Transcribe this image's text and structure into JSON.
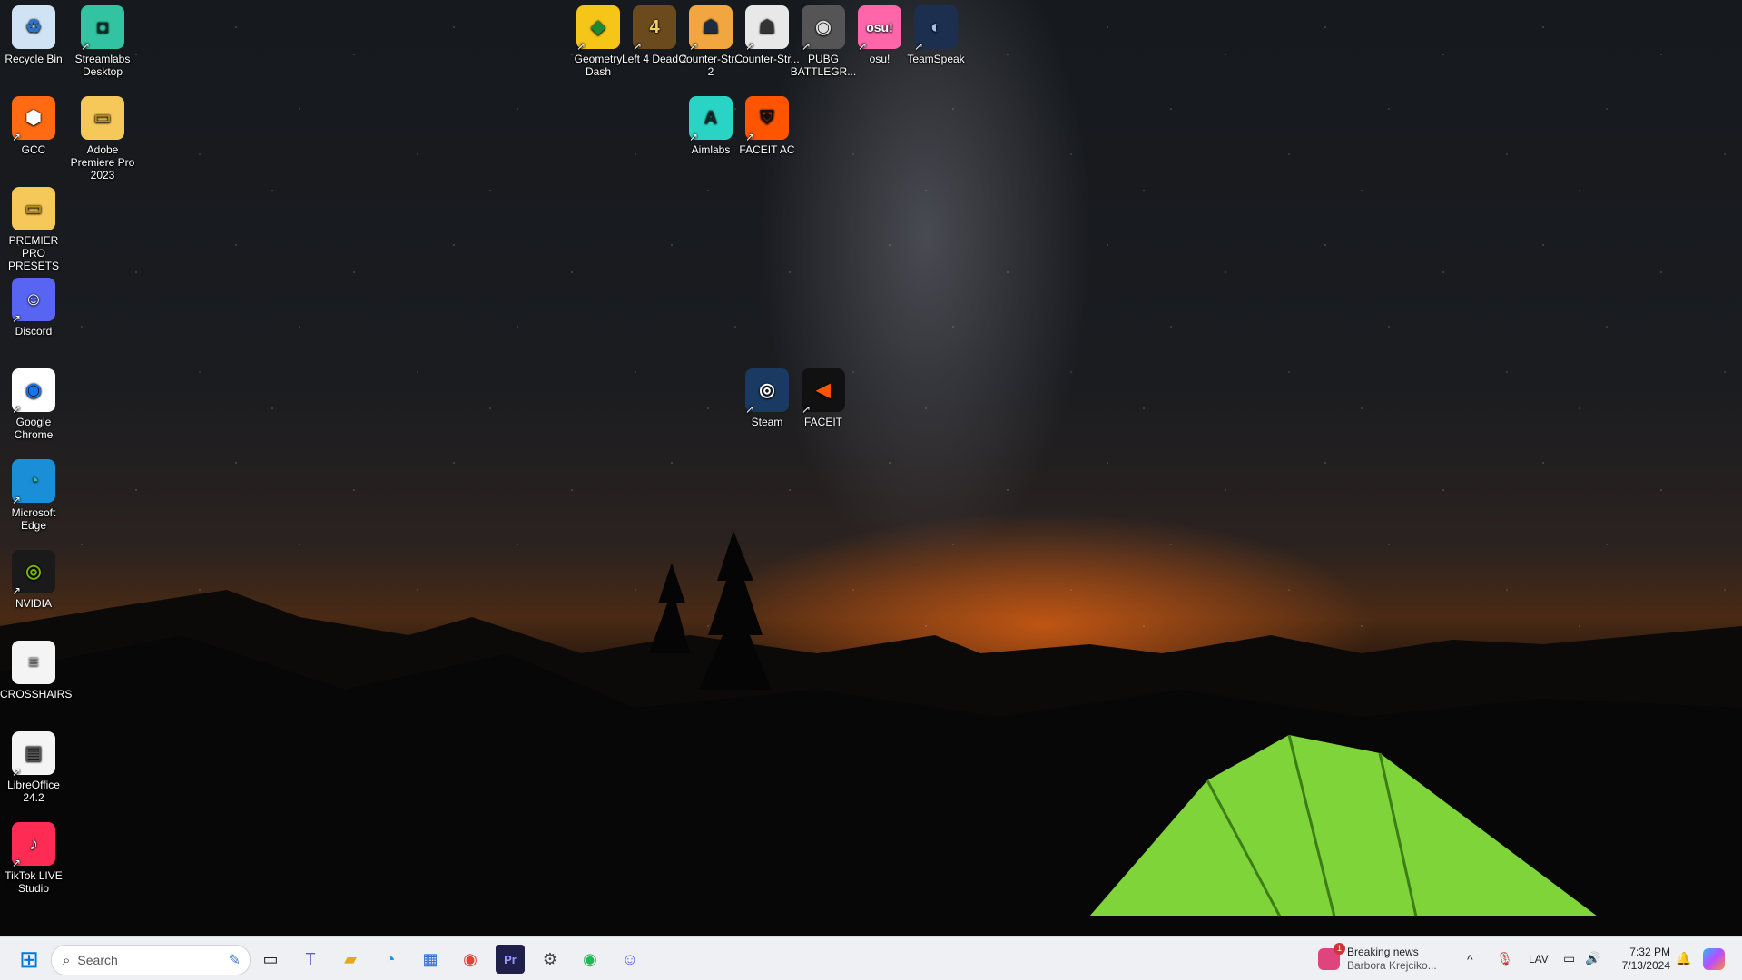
{
  "desktop": {
    "icons": [
      {
        "label": "Recycle Bin",
        "glyph": "♻",
        "bg": "#cfe3f5",
        "fg": "#2a73c9",
        "shortcut": false
      },
      {
        "label": "Streamlabs Desktop",
        "glyph": "◘",
        "bg": "#31c3a2",
        "fg": "#0a2a26",
        "shortcut": true
      },
      {
        "label": "Geometry Dash",
        "glyph": "◆",
        "bg": "#f5c518",
        "fg": "#1b8a32",
        "shortcut": true
      },
      {
        "label": "Left 4 Dead 2",
        "glyph": "4",
        "bg": "#6b4b1e",
        "fg": "#f0d060",
        "shortcut": true
      },
      {
        "label": "Counter-Str... 2",
        "glyph": "☗",
        "bg": "#f2a640",
        "fg": "#1d2b3f",
        "shortcut": true
      },
      {
        "label": "Counter-Str...",
        "glyph": "☗",
        "bg": "#e8e8e8",
        "fg": "#333",
        "shortcut": true
      },
      {
        "label": "PUBG BATTLEGR...",
        "glyph": "◉",
        "bg": "#555",
        "fg": "#ddd",
        "shortcut": true
      },
      {
        "label": "osu!",
        "glyph": "osu!",
        "bg": "#ff66aa",
        "fg": "#fff",
        "shortcut": true
      },
      {
        "label": "TeamSpeak",
        "glyph": "◐",
        "bg": "#1c2f4f",
        "fg": "#9fc3f0",
        "shortcut": true
      },
      {
        "label": "GCC",
        "glyph": "⬢",
        "bg": "#ff6a13",
        "fg": "#fff",
        "shortcut": true
      },
      {
        "label": "Adobe Premiere Pro 2023",
        "glyph": "▭",
        "bg": "#f6c85a",
        "fg": "#b88a1c",
        "shortcut": false
      },
      {
        "label": "Aimlabs",
        "glyph": "A",
        "bg": "#2ad4c4",
        "fg": "#102a2a",
        "shortcut": true
      },
      {
        "label": "FACEIT AC",
        "glyph": "⛨",
        "bg": "#ff5500",
        "fg": "#111",
        "shortcut": true
      },
      {
        "label": "PREMIER PRO PRESETS",
        "glyph": "▭",
        "bg": "#f6c85a",
        "fg": "#b88a1c",
        "shortcut": false
      },
      {
        "label": "Discord",
        "glyph": "☺",
        "bg": "#5865f2",
        "fg": "#fff",
        "shortcut": true
      },
      {
        "label": "Steam",
        "glyph": "◎",
        "bg": "#1b3a63",
        "fg": "#fff",
        "shortcut": true
      },
      {
        "label": "FACEIT",
        "glyph": "◀",
        "bg": "#111",
        "fg": "#ff5500",
        "shortcut": true
      },
      {
        "label": "Google Chrome",
        "glyph": "◉",
        "bg": "#fff",
        "fg": "#1a73e8",
        "shortcut": true
      },
      {
        "label": "Microsoft Edge",
        "glyph": "◔",
        "bg": "#1a8fd8",
        "fg": "#34c48b",
        "shortcut": true
      },
      {
        "label": "NVIDIA",
        "glyph": "◎",
        "bg": "#1a1a1a",
        "fg": "#76b900",
        "shortcut": true
      },
      {
        "label": "CROSSHAIRS",
        "glyph": "≡",
        "bg": "#f4f4f4",
        "fg": "#aaa",
        "shortcut": false
      },
      {
        "label": "LibreOffice 24.2",
        "glyph": "▤",
        "bg": "#f4f4f4",
        "fg": "#555",
        "shortcut": true
      },
      {
        "label": "TikTok LIVE Studio",
        "glyph": "♪",
        "bg": "#fe2c55",
        "fg": "#fff",
        "shortcut": true
      }
    ]
  },
  "taskbar": {
    "start_glyph": "⊞",
    "search_placeholder": "Search",
    "apps": [
      {
        "name": "task-view",
        "glyph": "▭",
        "color": "#222"
      },
      {
        "name": "teams",
        "glyph": "T",
        "color": "#5b5fc7"
      },
      {
        "name": "file-explorer",
        "glyph": "▰",
        "color": "#e6a817"
      },
      {
        "name": "edge",
        "glyph": "◔",
        "color": "#1a8fd8"
      },
      {
        "name": "store",
        "glyph": "▦",
        "color": "#2b6cd4"
      },
      {
        "name": "chrome",
        "glyph": "◉",
        "color": "#db4437"
      },
      {
        "name": "premiere-pro",
        "glyph": "Pr",
        "color": "#9999ff"
      },
      {
        "name": "settings",
        "glyph": "⚙",
        "color": "#444"
      },
      {
        "name": "spotify",
        "glyph": "◉",
        "color": "#1db954"
      },
      {
        "name": "discord",
        "glyph": "☺",
        "color": "#5865f2"
      }
    ],
    "news": {
      "badge": "1",
      "title": "Breaking news",
      "subtitle": "Barbora Krejciko..."
    },
    "tray": {
      "chevron": "^",
      "language": "LAV",
      "time": "7:32 PM",
      "date": "7/13/2024"
    }
  },
  "colors": {
    "taskbar_bg": "#eef0f4",
    "tent_green": "#7fd43a"
  }
}
